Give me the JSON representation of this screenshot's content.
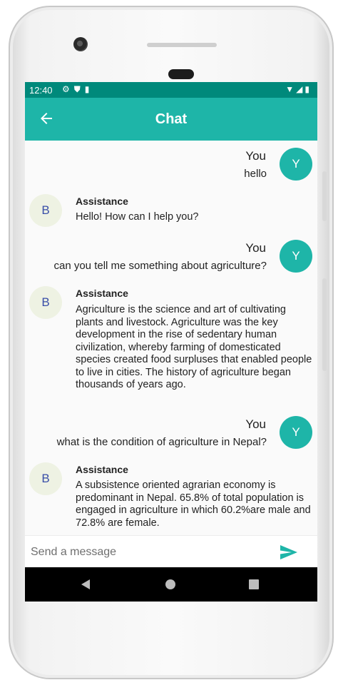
{
  "status_bar": {
    "time": "12:40",
    "left_icons": [
      "gear-icon",
      "shield-icon",
      "sd-card-icon"
    ],
    "right_icons": [
      "wifi-icon",
      "signal-icon",
      "battery-icon"
    ]
  },
  "app_bar": {
    "title": "Chat",
    "back_icon": "arrow-left-icon"
  },
  "messages": [
    {
      "role": "user",
      "sender": "You",
      "avatar": "Y",
      "text": "hello"
    },
    {
      "role": "bot",
      "sender": "Assistance",
      "avatar": "B",
      "text": "Hello! How can I help you?"
    },
    {
      "role": "user",
      "sender": "You",
      "avatar": "Y",
      "text": "can you tell me something about agriculture?"
    },
    {
      "role": "bot",
      "sender": "Assistance",
      "avatar": "B",
      "text": "Agriculture is the science and art of cultivating plants and livestock. Agriculture was the key development in the rise of sedentary human civilization, whereby farming of domesticated species created food surpluses that enabled people to live in cities. The history of agriculture began thousands of years ago."
    },
    {
      "role": "user",
      "sender": "You",
      "avatar": "Y",
      "text": "what is the condition of agriculture in Nepal?"
    },
    {
      "role": "bot",
      "sender": "Assistance",
      "avatar": "B",
      "text": "A subsistence oriented agrarian economy is predominant in Nepal. 65.8% of total population is engaged in agriculture in which 60.2%are male and 72.8% are female."
    }
  ],
  "composer": {
    "placeholder": "Send a message",
    "send_icon": "send-icon"
  },
  "colors": {
    "status_bar": "#00897b",
    "app_bar": "#1eb5a8",
    "user_avatar": "#1eb5a8",
    "bot_avatar": "#eef2e3",
    "send_icon": "#1eb5a8"
  }
}
